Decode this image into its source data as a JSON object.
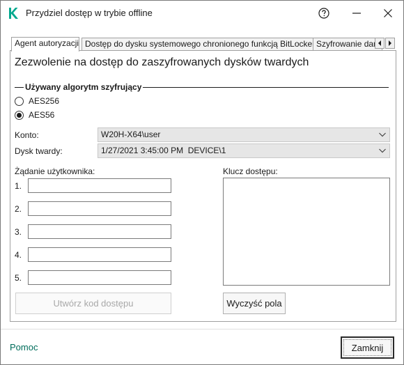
{
  "window": {
    "title": "Przydziel dostęp w trybie offline",
    "icons": {
      "logo": "kaspersky-k-logo",
      "help": "help-icon",
      "minimize": "minimize-icon",
      "close": "close-icon"
    },
    "accent": "#00a88e"
  },
  "tabs": [
    {
      "label": "Agent autoryzacji",
      "active": true
    },
    {
      "label": "Dostęp do dysku systemowego chronionego funkcją BitLocker",
      "active": false
    },
    {
      "label": "Szyfrowanie danych",
      "active": false
    }
  ],
  "main": {
    "heading": "Zezwolenie na dostęp do zaszyfrowanych dysków twardych",
    "algorithm": {
      "title": "Używany algorytm szyfrujący",
      "options": [
        {
          "label": "AES256",
          "checked": false
        },
        {
          "label": "AES56",
          "checked": true
        }
      ]
    },
    "account": {
      "label": "Konto:",
      "value": "W20H-X64\\user"
    },
    "drive": {
      "label": "Dysk twardy:",
      "value": "1/27/2021 3:45:00 PM  DEVICE\\1"
    },
    "request": {
      "label": "Żądanie użytkownika:",
      "fields": [
        {
          "num": "1.",
          "value": ""
        },
        {
          "num": "2.",
          "value": ""
        },
        {
          "num": "3.",
          "value": ""
        },
        {
          "num": "4.",
          "value": ""
        },
        {
          "num": "5.",
          "value": ""
        }
      ]
    },
    "key": {
      "label": "Klucz dostępu:",
      "value": ""
    },
    "buttons": {
      "generate": "Utwórz kod dostępu",
      "clear": "Wyczyść pola"
    }
  },
  "footer": {
    "help": "Pomoc",
    "close": "Zamknij"
  }
}
